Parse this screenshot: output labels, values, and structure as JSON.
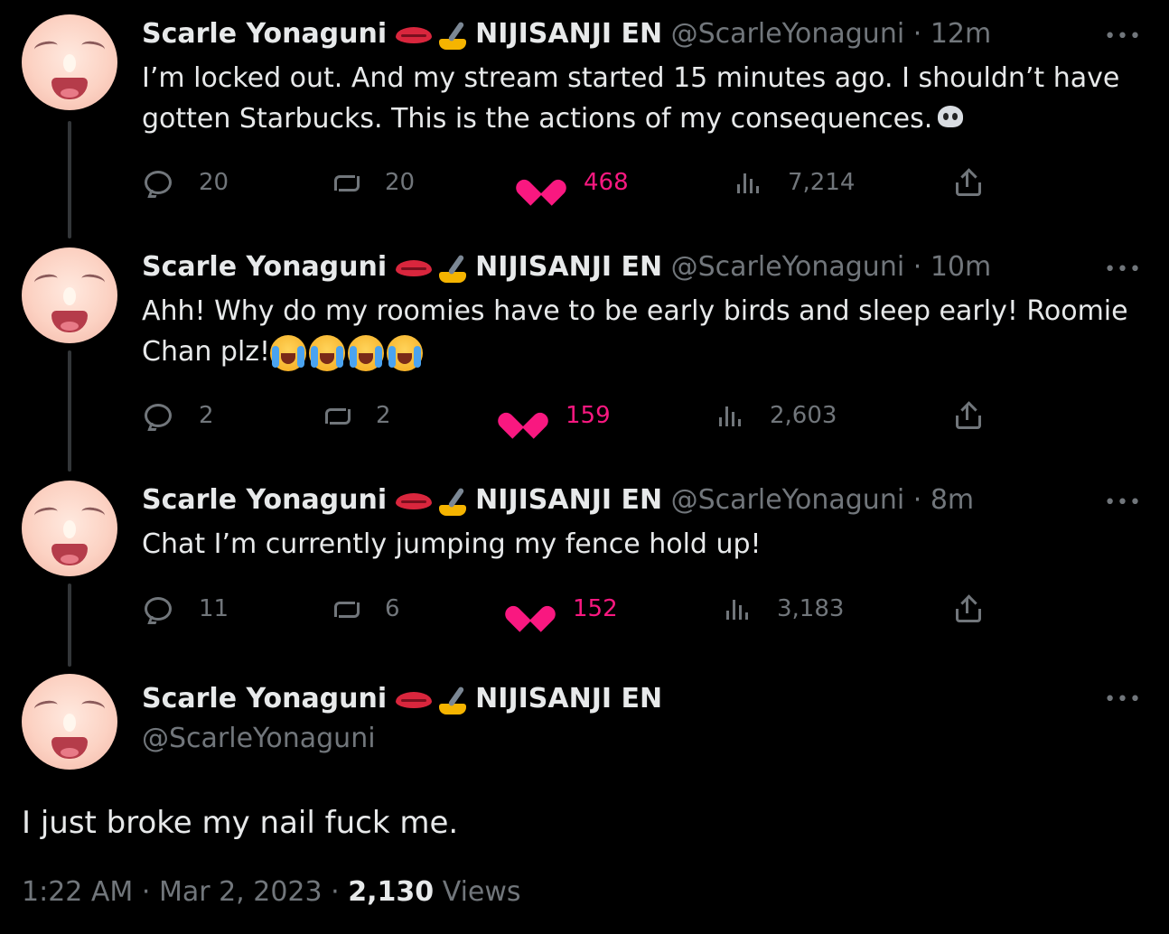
{
  "author": {
    "name": "Scarle Yonaguni",
    "affiliation": "NIJISANJI EN",
    "handle": "@ScarleYonaguni"
  },
  "thread": [
    {
      "time": "12m",
      "text": "I’m locked out. And my stream started 15 minutes ago. I shouldn’t have gotten Starbucks. This is the actions of my consequences.",
      "replies": "20",
      "retweets": "20",
      "likes": "468",
      "views": "7,214"
    },
    {
      "time": "10m",
      "text": "Ahh! Why do my roomies have to be early birds and sleep early! Roomie Chan plz!",
      "replies": "2",
      "retweets": "2",
      "likes": "159",
      "views": "2,603"
    },
    {
      "time": "8m",
      "text": "Chat I’m currently jumping my fence hold up!",
      "replies": "11",
      "retweets": "6",
      "likes": "152",
      "views": "3,183"
    }
  ],
  "main_tweet": {
    "text": "I just broke my nail fuck me.",
    "time": "1:22 AM",
    "date": "Mar 2, 2023",
    "views_count": "2,130",
    "views_label": "Views"
  },
  "ui": {
    "dot": "·",
    "more": "•••"
  },
  "icons": [
    "kiss-lips-icon",
    "nail-polish-icon",
    "skull-emoji",
    "loudly-crying-emoji",
    "reply-icon",
    "retweet-icon",
    "like-icon",
    "views-icon",
    "share-icon",
    "more-icon"
  ],
  "colors": {
    "background": "#000000",
    "text": "#e7e9ea",
    "muted": "#71767b",
    "like": "#f91880"
  }
}
